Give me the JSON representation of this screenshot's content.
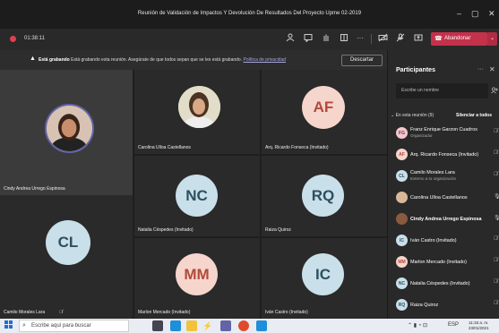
{
  "window": {
    "title": "Reunión de Validación de Impactos Y Devolución De Resultados Del Proyecto Upme 02-2019",
    "minimize": "–",
    "maximize": "▢",
    "close": "✕"
  },
  "toolbar": {
    "timer": "01:38:11",
    "leave_label": "Abandonar",
    "leave_dropdown": "⌄"
  },
  "banner": {
    "bold": "Está grabando",
    "text": " Está grabando esta reunión. Asegúrate de que todos sepan que se les está grabando. ",
    "link": "Política de privacidad",
    "dismiss_label": "Descartar"
  },
  "tiles": [
    {
      "name": "Cindy Andrea Urrego Espinosa",
      "type": "photo"
    },
    {
      "name": "Carolina Ulloa Castellanos",
      "type": "photo"
    },
    {
      "name": "Arq. Ricardo Fonseca (Invitado)",
      "initials": "AF",
      "muted": true
    },
    {
      "name": "Natalia Céspedes (Invitado)",
      "initials": "NC",
      "muted": true
    },
    {
      "name": "Raiza Quiroz",
      "initials": "RQ",
      "muted": true
    },
    {
      "name": "Camilo Morales Lara",
      "initials": "CL",
      "muted": true
    },
    {
      "name": "Marlon Mercado (Invitado)",
      "initials": "MM",
      "muted": true
    },
    {
      "name": "Iván Castro (Invitado)",
      "initials": "IC",
      "muted": true
    }
  ],
  "panel": {
    "title": "Participantes",
    "more": "···",
    "close": "✕",
    "search_placeholder": "Escribe un nombre",
    "section_label": "En esta reunión (9)",
    "mute_all": "Silenciar a todos",
    "participants": [
      {
        "name": "Franz Enrique Garzon Cuadros",
        "sub": "Organizador",
        "initials": "FG"
      },
      {
        "name": "Arq. Ricardo Fonseca (Invitado)",
        "sub": "",
        "initials": "AF"
      },
      {
        "name": "Camilo Morales Lara",
        "sub": "Externo a tu organización",
        "initials": "CL"
      },
      {
        "name": "Carolina Ulloa Castellanos",
        "sub": "",
        "initials": ""
      },
      {
        "name": "Cindy Andrea Urrego Espinosa",
        "sub": "",
        "initials": ""
      },
      {
        "name": "Iván Castro (Invitado)",
        "sub": "",
        "initials": "IC"
      },
      {
        "name": "Marlon Mercado (Invitado)",
        "sub": "",
        "initials": "MM"
      },
      {
        "name": "Natalia Céspedes (Invitado)",
        "sub": "",
        "initials": "NC"
      },
      {
        "name": "Raiza Quiroz",
        "sub": "",
        "initials": "RQ"
      }
    ]
  },
  "taskbar": {
    "search_placeholder": "Escribe aquí para buscar",
    "time": "11:33 a. m.",
    "date": "23/01/2021"
  },
  "colors": {
    "leave": "#c4314b",
    "accent": "#6264a7",
    "tile_bg": "#2a2a2a"
  }
}
